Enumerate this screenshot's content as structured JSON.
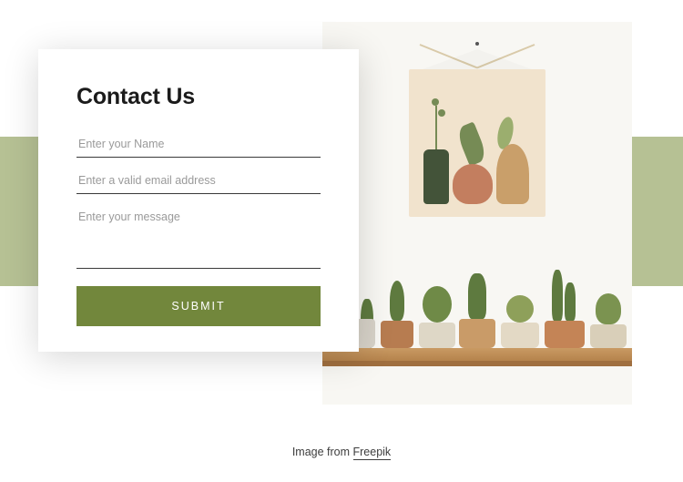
{
  "form": {
    "title": "Contact Us",
    "name_placeholder": "Enter your Name",
    "email_placeholder": "Enter a valid email address",
    "message_placeholder": "Enter your message",
    "submit_label": "SUBMIT"
  },
  "credit": {
    "prefix": "Image from ",
    "link_label": "Freepik"
  },
  "colors": {
    "accent": "#72873c",
    "sage": "#b6c194"
  }
}
